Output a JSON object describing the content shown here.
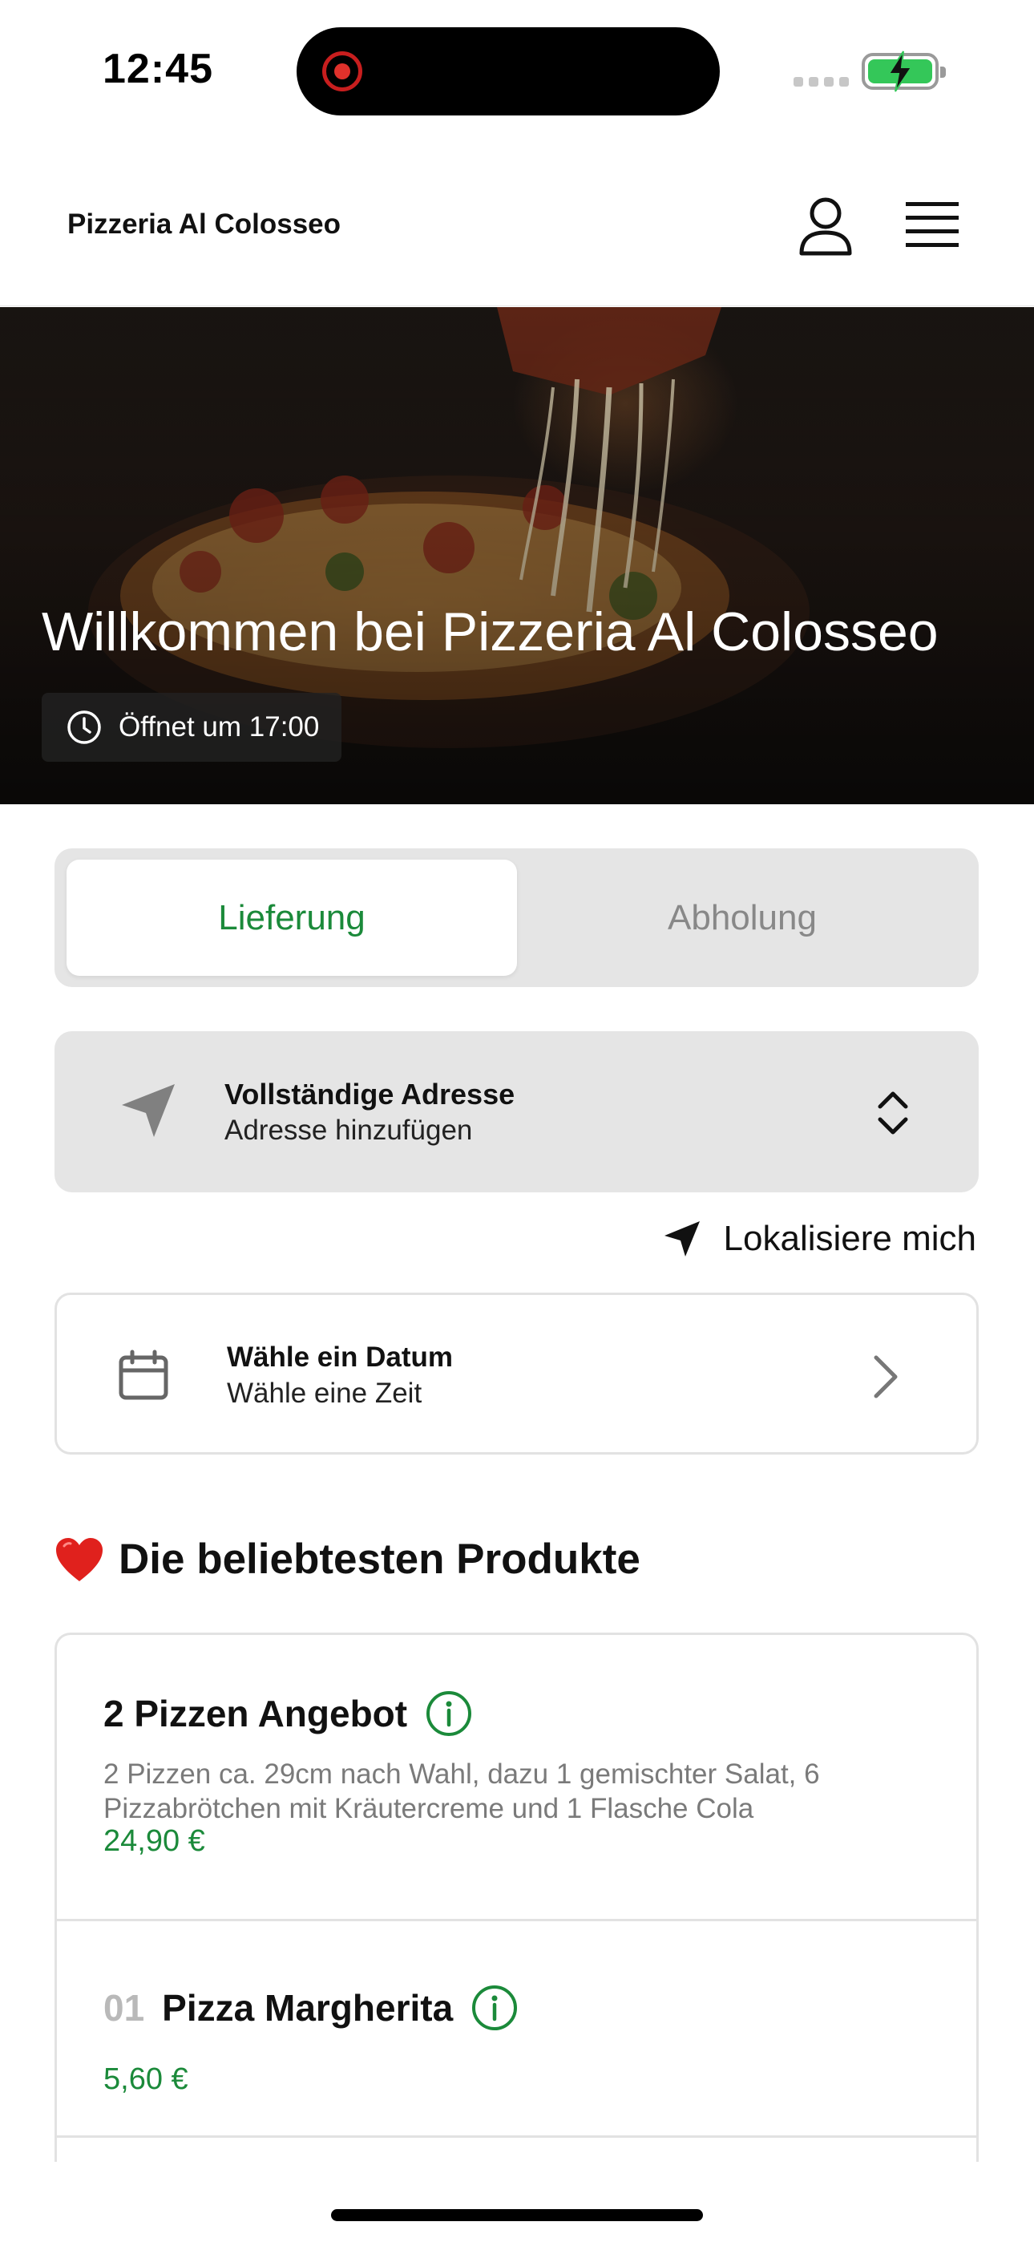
{
  "status_bar": {
    "time": "12:45"
  },
  "header": {
    "title": "Pizzeria Al Colosseo",
    "user_icon": "user-icon",
    "menu_icon": "hamburger-menu-icon"
  },
  "hero": {
    "title": "Willkommen bei Pizzeria Al Colosseo",
    "hours": "Öffnet um 17:00",
    "clock_icon": "clock-icon"
  },
  "order_mode": {
    "tabs": [
      "Lieferung",
      "Abholung"
    ],
    "selected": "Lieferung",
    "accent_color": "#1b8a3a"
  },
  "address": {
    "title": "Vollständige Adresse",
    "placeholder": "Adresse hinzufügen",
    "icon": "navigation-arrow-icon",
    "toggle_icon": "chevron-up-down-icon"
  },
  "localize": {
    "label": "Lokalisiere mich",
    "icon": "location-arrow-icon"
  },
  "schedule": {
    "title": "Wähle ein Datum",
    "subtitle": "Wähle eine Zeit",
    "icon": "calendar-icon",
    "chevron_icon": "chevron-right-icon"
  },
  "popular": {
    "title": "Die beliebtesten Produkte",
    "emoji_icon": "heart-icon",
    "products": [
      {
        "number": "",
        "name": "2 Pizzen Angebot",
        "description": "2 Pizzen ca. 29cm nach Wahl, dazu 1 gemischter Salat, 6 Pizzabrötchen mit Kräutercreme und 1 Flasche Cola",
        "price": "24,90 €"
      },
      {
        "number": "01",
        "name": "Pizza Margherita",
        "description": "",
        "price": "5,60 €"
      }
    ]
  }
}
